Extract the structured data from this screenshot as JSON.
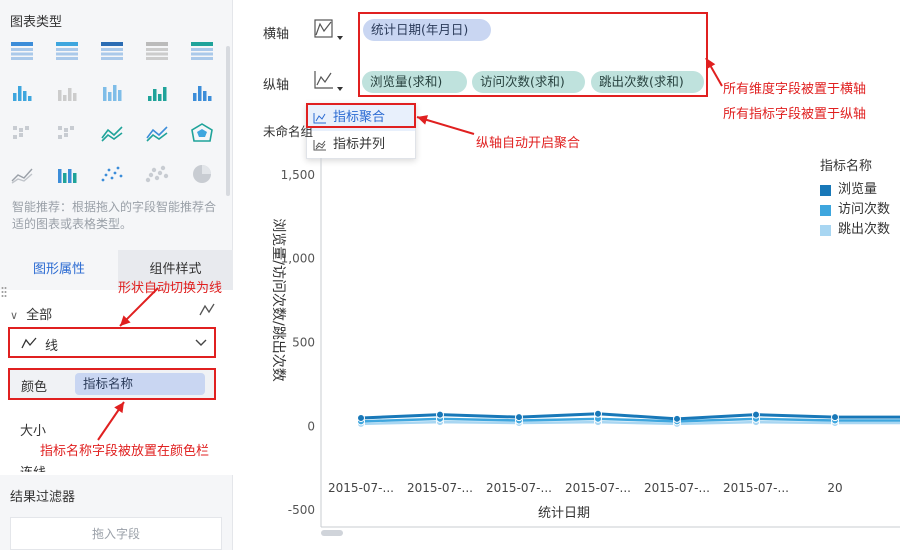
{
  "left_panel": {
    "chart_type_title": "图表类型",
    "chart_types": [
      "table",
      "cross-table",
      "detail-table",
      "kpi-number",
      "filled-table",
      "dot-chart",
      "heatmap",
      "grouped-bar",
      "bar",
      "stacked-bar",
      "matrix",
      "scatter-small",
      "line-multi",
      "line",
      "radar",
      "area",
      "stacked-area-bar",
      "scatter",
      "bubble",
      "pie"
    ],
    "smart_hint": "智能推荐：根据拖入的字段智能推荐合适的图表或表格类型。",
    "tabs": [
      "图形属性",
      "组件样式"
    ],
    "all_label": "全部",
    "shape_value": "线",
    "color_label": "颜色",
    "color_field": "指标名称",
    "size_label": "大小",
    "cut_label": "连线",
    "result_filter_title": "结果过滤器",
    "drop_hint": "拖入字段"
  },
  "axes": {
    "x_label": "横轴",
    "y_label": "纵轴",
    "x_fields": [
      "统计日期(年月日)"
    ],
    "y_fields": [
      "浏览量(求和)",
      "访问次数(求和)",
      "跳出次数(求和)"
    ]
  },
  "dropdown": {
    "items": [
      "指标聚合",
      "指标并列"
    ],
    "selected": "指标聚合"
  },
  "chart_title": "未命名组",
  "annotations": {
    "right1": "所有维度字段被置于横轴",
    "right2": "所有指标字段被置于纵轴",
    "aggregate": "纵轴自动开启聚合",
    "shape": "形状自动切换为线",
    "color": "指标名称字段被放置在颜色栏"
  },
  "colors": {
    "accent": "#2a6ad2",
    "annotation_red": "#e02020",
    "series1": "#1878b8",
    "series2": "#3ea6de",
    "series3": "#a8d6f2"
  },
  "chart_data": {
    "type": "line",
    "title": "",
    "xlabel": "统计日期",
    "ylabel": "浏览量/访问次数/跳出次数",
    "ylim": [
      -600,
      1600
    ],
    "y_ticks": [
      -500,
      0,
      500,
      1000,
      1500
    ],
    "y_tick_labels": [
      "-500",
      "0",
      "500",
      "1,000",
      "1,500"
    ],
    "categories": [
      "2015-07-...",
      "2015-07-...",
      "2015-07-...",
      "2015-07-...",
      "2015-07-...",
      "2015-07-...",
      "20"
    ],
    "legend_title": "指标名称",
    "legend_position": "right",
    "grid": false,
    "series": [
      {
        "name": "浏览量",
        "values": [
          50,
          70,
          55,
          75,
          45,
          70,
          55
        ]
      },
      {
        "name": "访问次数",
        "values": [
          30,
          45,
          35,
          45,
          30,
          45,
          35
        ]
      },
      {
        "name": "跳出次数",
        "values": [
          15,
          25,
          20,
          25,
          15,
          25,
          20
        ]
      }
    ]
  }
}
